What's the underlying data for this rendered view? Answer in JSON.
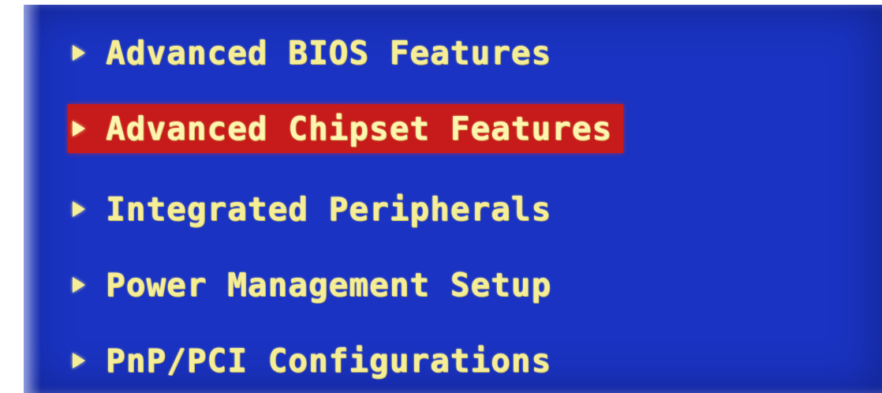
{
  "bios_menu": {
    "items": [
      {
        "label": "Advanced BIOS Features",
        "selected": false
      },
      {
        "label": "Advanced Chipset Features",
        "selected": true
      },
      {
        "label": "Integrated Peripherals",
        "selected": false
      },
      {
        "label": "Power Management Setup",
        "selected": false
      },
      {
        "label": "PnP/PCI Configurations",
        "selected": false
      }
    ],
    "item_icon": "triangle-right-icon"
  },
  "colors": {
    "background": "#1a33c2",
    "text": "#f5ee96",
    "highlight": "#c71a1a"
  }
}
